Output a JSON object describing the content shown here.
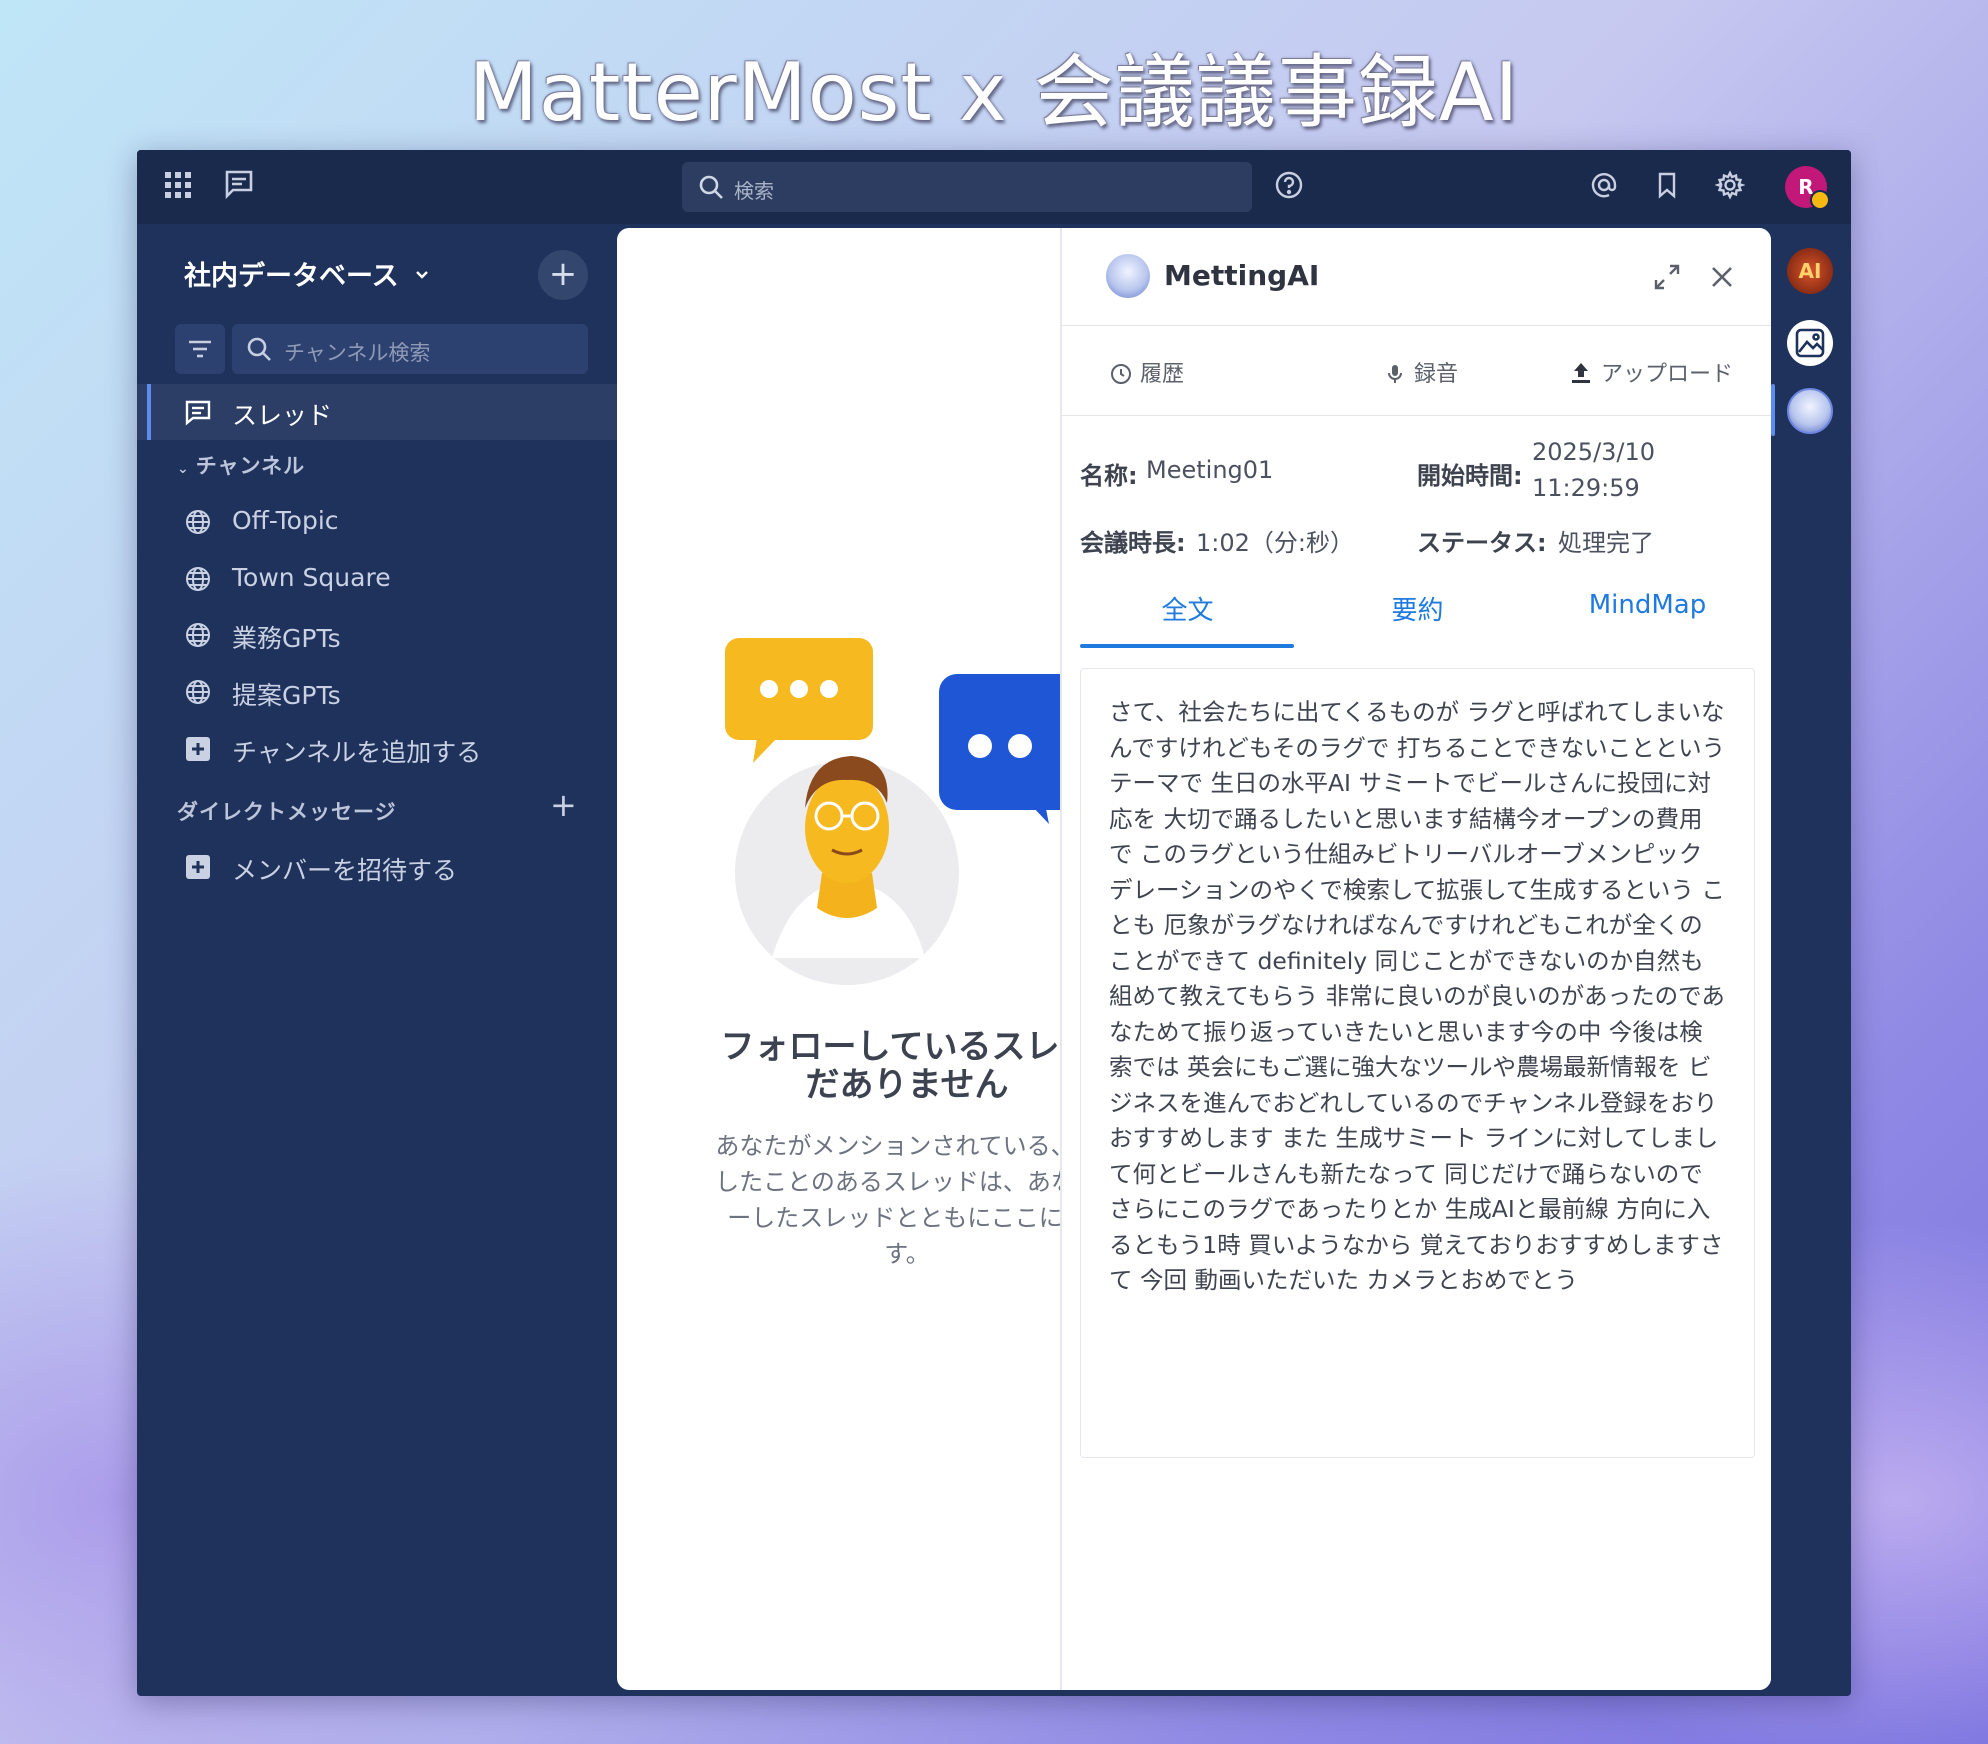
{
  "banner": {
    "title": "MatterMost x 会議議事録AI"
  },
  "topbar": {
    "search_placeholder": "検索",
    "user_initial": "R"
  },
  "sidebar": {
    "team_name": "社内データベース",
    "search_placeholder": "チャンネル検索",
    "threads_label": "スレッド",
    "channels_header": "チャンネル",
    "channels": [
      {
        "label": "Off-Topic",
        "icon": "globe-icon"
      },
      {
        "label": "Town Square",
        "icon": "globe-icon"
      },
      {
        "label": "業務GPTs",
        "icon": "globe-icon"
      },
      {
        "label": "提案GPTs",
        "icon": "globe-icon"
      }
    ],
    "add_channel_label": "チャンネルを追加する",
    "dm_header": "ダイレクトメッセージ",
    "invite_label": "メンバーを招待する"
  },
  "threads_empty": {
    "title_line1": "フォローしているスレッ",
    "title_line2": "だありません",
    "desc_line1": "あなたがメンションされている、ま",
    "desc_line2": "したことのあるスレッドは、あなた",
    "desc_line3": "ーしたスレッドとともにここに表",
    "desc_line4": "す。"
  },
  "panel": {
    "title": "MettingAI",
    "tabs": {
      "history": "履歴",
      "record": "録音",
      "upload": "アップロード"
    },
    "meta": {
      "name_label": "名称:",
      "name_value": "Meeting01",
      "start_label": "開始時間:",
      "start_date": "2025/3/10",
      "start_time": "11:29:59",
      "duration_label": "会議時長:",
      "duration_value": "1:02（分:秒）",
      "status_label": "ステータス:",
      "status_value": "処理完了"
    },
    "content_tabs": [
      "全文",
      "要約",
      "MindMap"
    ],
    "active_content_tab": "全文",
    "transcript": "さて、社会たちに出てくるものが ラグと呼ばれてしまいなんですけれどもそのラグで 打ちることできないことというテーマで 生日の水平AI サミートでビールさんに投団に対応を 大切で踊るしたいと思います結構今オープンの費用で このラグという仕組みビトリーバルオーブメンピック デレーションのやくで検索して拡張して生成するという ことも 厄象がラグなければなんですけれどもこれが全くのことができて  definitely 同じことができないのか自然も組めて教えてもらう 非常に良いのが良いのがあったのであなためて振り返っていきたいと思います今の中 今後は検索では 英会にもご選に強大なツールや農場最新情報を ビジネスを進んでおどれしているのでチャンネル登録をおりおすすめします また 生成サミート ラインに対してしまして何とビールさんも新たなって 同じだけで踊らないのでさらにこのラグであったりとか 生成AIと最前線 方向に入るともう1時 買いようなから 覚えておりおすすめしますさて 今回 動画いただいた カメラとおめでとう"
  },
  "colors": {
    "sidebar_bg": "#1e325c",
    "topbar_bg": "#1a2a4d",
    "accent": "#1f7ae0",
    "avatar": "#c2187a"
  }
}
